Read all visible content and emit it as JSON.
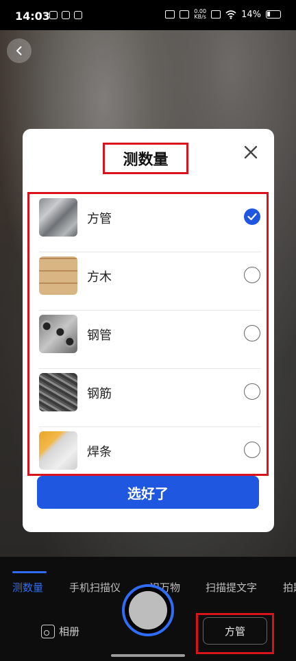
{
  "status_bar": {
    "time": "14:03",
    "net_speed_value": "0.00",
    "net_speed_unit": "KB/s",
    "battery": "14%"
  },
  "dialog": {
    "title": "测数量",
    "confirm_label": "选好了",
    "selected_index": 0,
    "items": [
      {
        "label": "方管",
        "thumb_icon": "square-tube-image",
        "checked": true
      },
      {
        "label": "方木",
        "thumb_icon": "timber-image",
        "checked": false
      },
      {
        "label": "钢管",
        "thumb_icon": "steel-pipe-image",
        "checked": false
      },
      {
        "label": "钢筋",
        "thumb_icon": "rebar-image",
        "checked": false
      },
      {
        "label": "焊条",
        "thumb_icon": "welding-rod-image",
        "checked": false
      }
    ]
  },
  "modes": [
    {
      "label": "测数量",
      "active": true
    },
    {
      "label": "手机扫描仪",
      "active": false
    },
    {
      "label": "识万物",
      "active": false
    },
    {
      "label": "扫描提文字",
      "active": false
    },
    {
      "label": "拍题",
      "active": false
    }
  ],
  "bottom": {
    "album_label": "相册",
    "current_type_label": "方管"
  },
  "colors": {
    "accent": "#1f57e0",
    "mode_active": "#2f6df6",
    "highlight_box": "#d9121b"
  }
}
